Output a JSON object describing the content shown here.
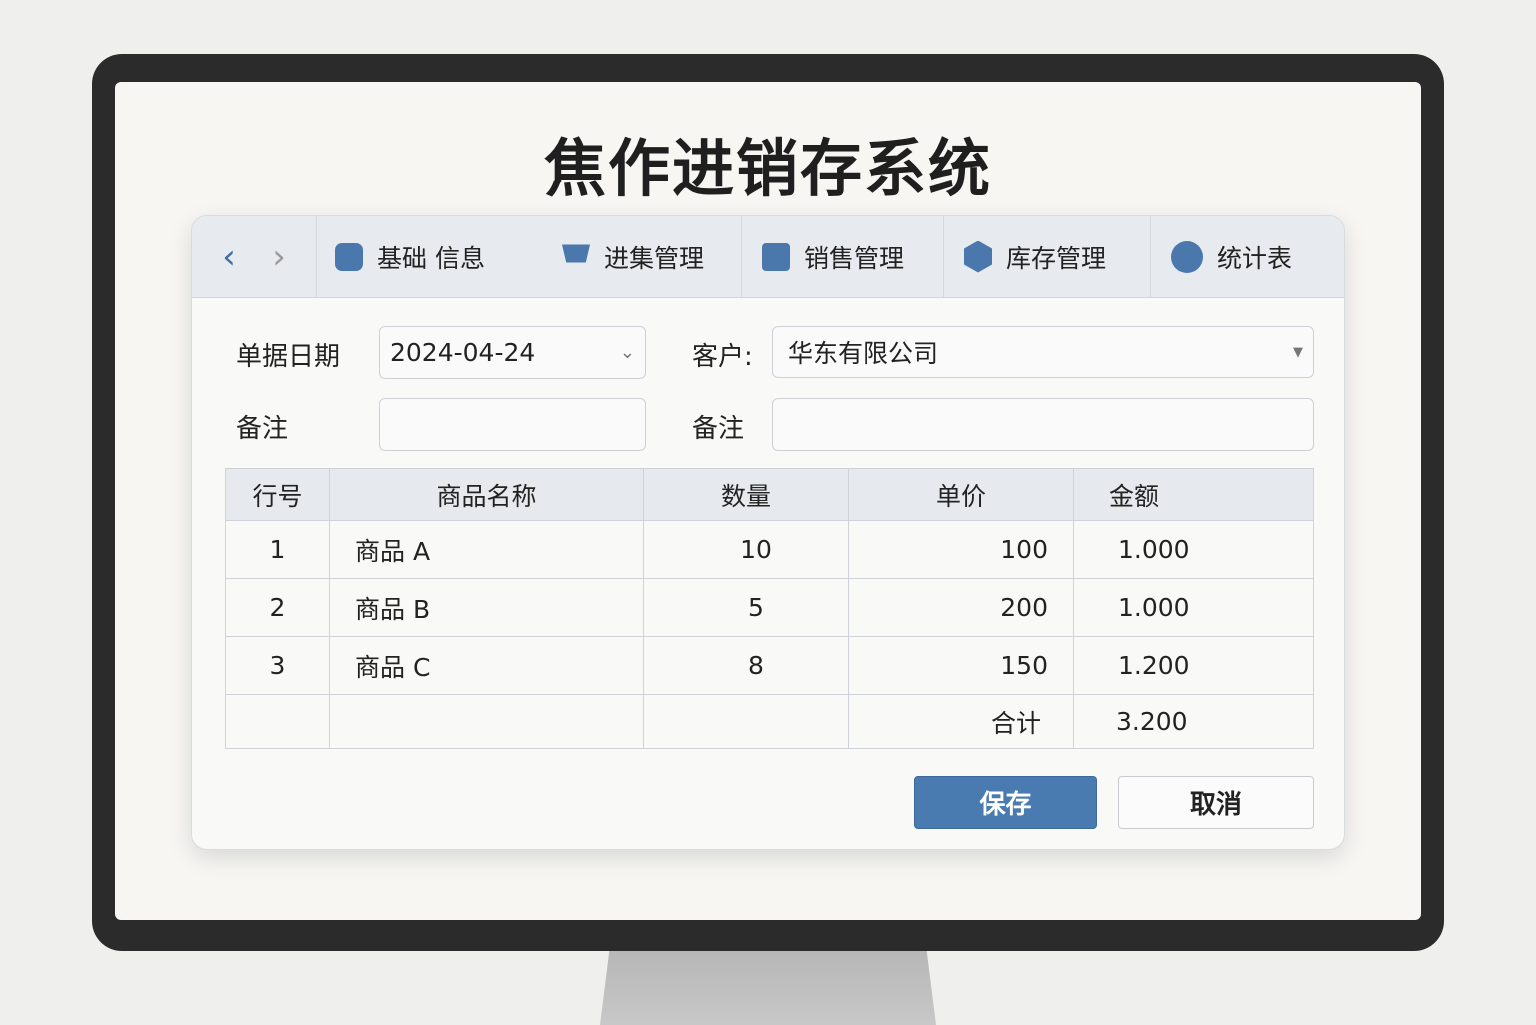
{
  "title": "焦作进销存系统",
  "tabs": [
    {
      "label": "基础 信息",
      "icon": "base-info-icon"
    },
    {
      "label": "进集管理",
      "icon": "cart-icon"
    },
    {
      "label": "销售管理",
      "icon": "document-icon"
    },
    {
      "label": "库存管理",
      "icon": "box-icon"
    },
    {
      "label": "统计表",
      "icon": "pie-chart-icon"
    }
  ],
  "form": {
    "date_label": "单据日期",
    "date_value": "2024-04-24",
    "customer_label": "客户:",
    "customer_value": "华东有限公司",
    "note_label": "备注",
    "note2_label": "备注",
    "note_value": "",
    "note2_value": ""
  },
  "table": {
    "headers": [
      "行号",
      "商品名称",
      "数量",
      "单价",
      "金额"
    ],
    "rows": [
      [
        "1",
        "商品 A",
        "10",
        "100",
        "1.000"
      ],
      [
        "2",
        "商品 B",
        "5",
        "200",
        "1.000"
      ],
      [
        "3",
        "商品 C",
        "8",
        "150",
        "1.200"
      ]
    ],
    "total_label": "合计",
    "total_value": "3.200"
  },
  "buttons": {
    "save": "保存",
    "cancel": "取消"
  },
  "colors": {
    "accent": "#4a7bb0",
    "frame": "#2b2b2b"
  }
}
